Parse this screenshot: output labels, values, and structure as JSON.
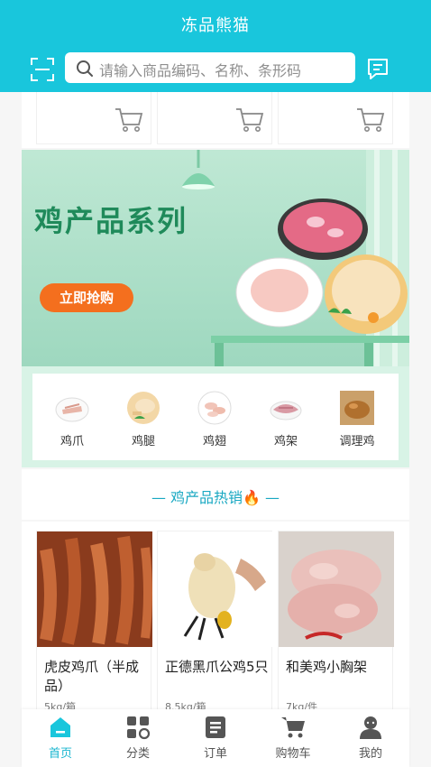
{
  "header": {
    "title": "冻品熊猫",
    "search_placeholder": "请输入商品编码、名称、条形码",
    "bg_color": "#19c6dc"
  },
  "banner": {
    "title": "鸡产品系列",
    "button_label": "立即抢购",
    "button_color": "#f46f1e"
  },
  "categories": [
    {
      "label": "鸡爪",
      "icon": "chicken-feet-icon"
    },
    {
      "label": "鸡腿",
      "icon": "chicken-leg-icon"
    },
    {
      "label": "鸡翅",
      "icon": "chicken-wing-icon"
    },
    {
      "label": "鸡架",
      "icon": "chicken-frame-icon"
    },
    {
      "label": "调理鸡",
      "icon": "seasoned-chicken-icon"
    }
  ],
  "hot": {
    "title": "— 鸡产品热销🔥 —"
  },
  "products": [
    {
      "name": "虎皮鸡爪（半成品）",
      "spec": "5kg/箱"
    },
    {
      "name": "正德黑爪公鸡5只",
      "spec": "8.5kg/箱"
    },
    {
      "name": "和美鸡小胸架",
      "spec": "7kg/件"
    }
  ],
  "tabs": [
    {
      "label": "首页",
      "icon": "home-icon",
      "active": true
    },
    {
      "label": "分类",
      "icon": "category-icon",
      "active": false
    },
    {
      "label": "订单",
      "icon": "order-icon",
      "active": false
    },
    {
      "label": "购物车",
      "icon": "cart-icon",
      "active": false
    },
    {
      "label": "我的",
      "icon": "profile-icon",
      "active": false
    }
  ],
  "accent_color": "#19b6cf"
}
